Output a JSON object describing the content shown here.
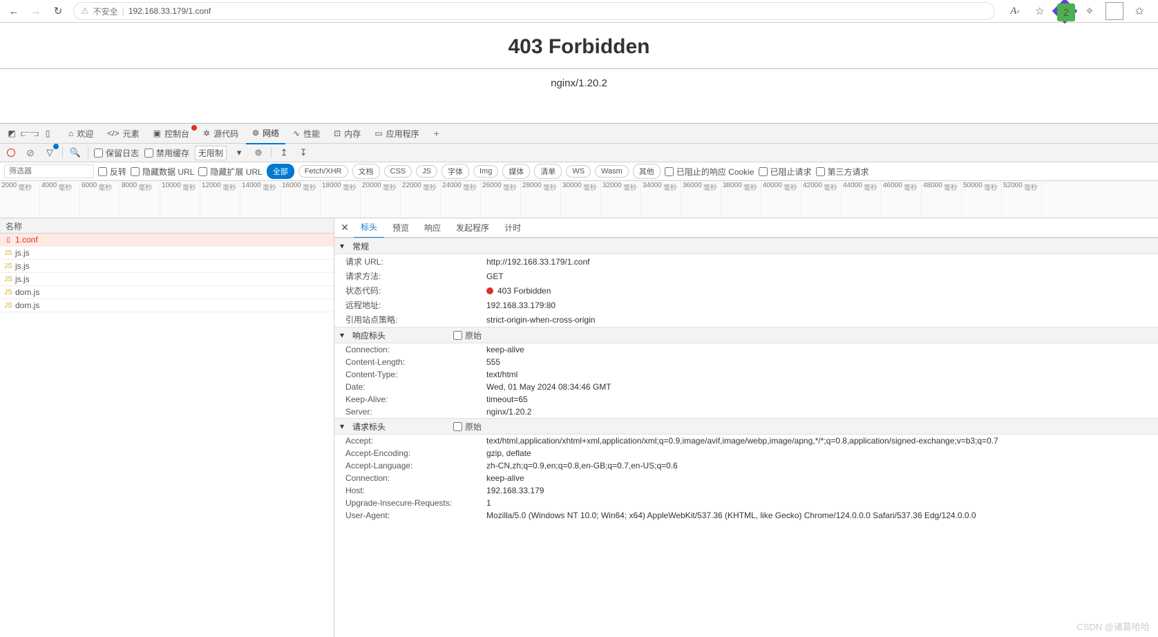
{
  "browser": {
    "security_text": "不安全",
    "url": "192.168.33.179/1.conf",
    "ext_badge": "2"
  },
  "page": {
    "heading": "403 Forbidden",
    "server": "nginx/1.20.2"
  },
  "devtools_tabs": {
    "welcome": "欢迎",
    "elements": "元素",
    "console": "控制台",
    "sources": "源代码",
    "network": "网络",
    "performance": "性能",
    "memory": "内存",
    "application": "应用程序"
  },
  "toolbar": {
    "preserve_log": "保留日志",
    "disable_cache": "禁用缓存",
    "throttle": "无限制"
  },
  "filter": {
    "placeholder": "筛选器",
    "invert": "反转",
    "hide_data_url": "隐藏数据 URL",
    "hide_ext_url": "隐藏扩展 URL",
    "all": "全部",
    "fetch_xhr": "Fetch/XHR",
    "doc": "文档",
    "css": "CSS",
    "js": "JS",
    "font": "字体",
    "img": "Img",
    "media": "媒体",
    "manifest": "清单",
    "ws": "WS",
    "wasm": "Wasm",
    "other": "其他",
    "blocked_cookie": "已阻止的响应 Cookie",
    "blocked_req": "已阻止请求",
    "third_party": "第三方请求"
  },
  "timeline_unit": "毫秒",
  "list_header": "名称",
  "requests": [
    {
      "name": "1.conf",
      "type": "conf"
    },
    {
      "name": "js.js",
      "type": "js"
    },
    {
      "name": "js.js",
      "type": "js"
    },
    {
      "name": "js.js",
      "type": "js"
    },
    {
      "name": "dom.js",
      "type": "js"
    },
    {
      "name": "dom.js",
      "type": "js"
    }
  ],
  "detail_tabs": {
    "headers": "标头",
    "preview": "预览",
    "response": "响应",
    "initiator": "发起程序",
    "timing": "计时"
  },
  "sections": {
    "general": "常规",
    "response_headers": "响应标头",
    "request_headers": "请求标头",
    "raw": "原始"
  },
  "general": {
    "url_label": "请求 URL:",
    "url_value": "http://192.168.33.179/1.conf",
    "method_label": "请求方法:",
    "method_value": "GET",
    "status_label": "状态代码:",
    "status_value": "403 Forbidden",
    "remote_label": "远程地址:",
    "remote_value": "192.168.33.179:80",
    "referrer_label": "引用站点策略:",
    "referrer_value": "strict-origin-when-cross-origin"
  },
  "resp_headers": [
    {
      "k": "Connection:",
      "v": "keep-alive"
    },
    {
      "k": "Content-Length:",
      "v": "555"
    },
    {
      "k": "Content-Type:",
      "v": "text/html"
    },
    {
      "k": "Date:",
      "v": "Wed, 01 May 2024 08:34:46 GMT"
    },
    {
      "k": "Keep-Alive:",
      "v": "timeout=65"
    },
    {
      "k": "Server:",
      "v": "nginx/1.20.2"
    }
  ],
  "req_headers": [
    {
      "k": "Accept:",
      "v": "text/html,application/xhtml+xml,application/xml;q=0.9,image/avif,image/webp,image/apng,*/*;q=0.8,application/signed-exchange;v=b3;q=0.7"
    },
    {
      "k": "Accept-Encoding:",
      "v": "gzip, deflate"
    },
    {
      "k": "Accept-Language:",
      "v": "zh-CN,zh;q=0.9,en;q=0.8,en-GB;q=0.7,en-US;q=0.6"
    },
    {
      "k": "Connection:",
      "v": "keep-alive"
    },
    {
      "k": "Host:",
      "v": "192.168.33.179"
    },
    {
      "k": "Upgrade-Insecure-Requests:",
      "v": "1"
    },
    {
      "k": "User-Agent:",
      "v": "Mozilla/5.0 (Windows NT 10.0; Win64; x64) AppleWebKit/537.36 (KHTML, like Gecko) Chrome/124.0.0.0 Safari/537.36 Edg/124.0.0.0"
    }
  ],
  "watermark": "CSDN @诸葛哈哈"
}
